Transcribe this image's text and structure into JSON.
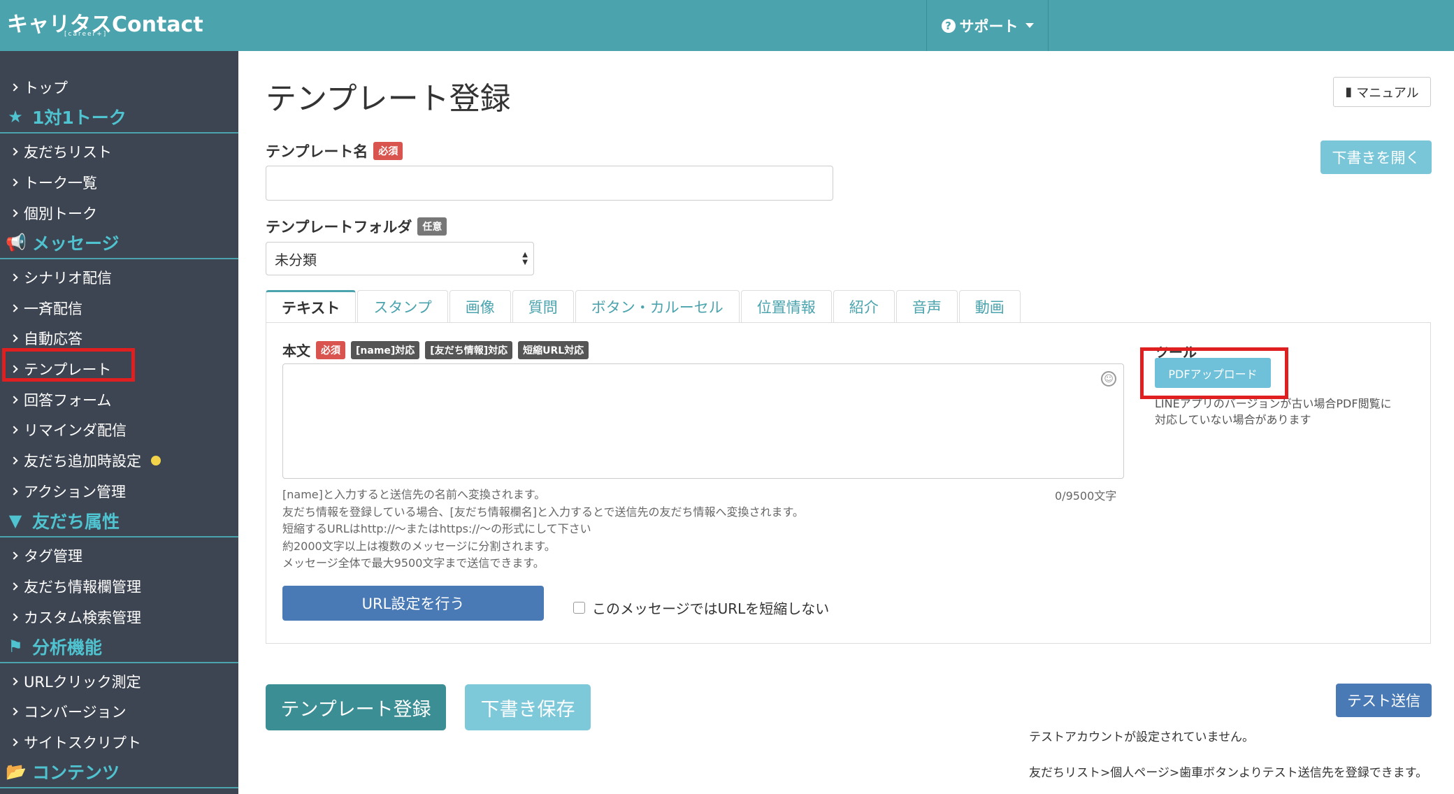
{
  "header": {
    "logo": "キャリタスContact",
    "logo_sub": "[career+]",
    "support_label": "サポート"
  },
  "sidebar": {
    "top": "トップ",
    "section_talk": "1対1トーク",
    "friend_list": "友だちリスト",
    "talk_list": "トーク一覧",
    "individual_talk": "個別トーク",
    "section_message": "メッセージ",
    "scenario": "シナリオ配信",
    "broadcast": "一斉配信",
    "auto_reply": "自動応答",
    "template": "テンプレート",
    "answer_form": "回答フォーム",
    "reminder": "リマインダ配信",
    "friend_add": "友だち追加時設定",
    "action": "アクション管理",
    "section_attr": "友だち属性",
    "tag": "タグ管理",
    "friend_info": "友だち情報欄管理",
    "custom_search": "カスタム検索管理",
    "section_analysis": "分析機能",
    "url_click": "URLクリック測定",
    "conversion": "コンバージョン",
    "site_script": "サイトスクリプト",
    "section_contents": "コンテンツ"
  },
  "main": {
    "title": "テンプレート登録",
    "manual": "マニュアル",
    "open_draft": "下書きを開く",
    "name_label": "テンプレート名",
    "required": "必須",
    "folder_label": "テンプレートフォルダ",
    "optional": "任意",
    "folder_value": "未分類",
    "tabs": [
      "テキスト",
      "スタンプ",
      "画像",
      "質問",
      "ボタン・カルーセル",
      "位置情報",
      "紹介",
      "音声",
      "動画"
    ],
    "body_label": "本文",
    "badge_name": "[name]対応",
    "badge_friend": "[友だち情報]対応",
    "badge_short": "短縮URL対応",
    "counter": "0/9500文字",
    "help": [
      "[name]と入力すると送信先の名前へ変換されます。",
      "友だち情報を登録している場合、[友だち情報欄名]と入力するとで送信先の友だち情報へ変換されます。",
      "短縮するURLはhttp://〜またはhttps://〜の形式にして下さい",
      "約2000文字以上は複数のメッセージに分割されます。",
      "メッセージ全体で最大9500文字まで送信できます。"
    ],
    "url_button": "URL設定を行う",
    "no_shorten": "このメッセージではURLを短縮しない",
    "tool_title": "ツール",
    "pdf_button": "PDFアップロード",
    "tool_note1": "LINEアプリのバージョンが古い場合PDF閲覧に",
    "tool_note2": "対応していない場合があります",
    "register": "テンプレート登録",
    "save_draft": "下書き保存",
    "test_send": "テスト送信",
    "test_note1": "テストアカウントが設定されていません。",
    "test_note2": "友だちリスト>個人ページ>歯車ボタンよりテスト送信先を登録できます。"
  },
  "colors": {
    "header": "#4aa3ad",
    "sidebar": "#3e4552",
    "accent": "#4fc3d0",
    "highlight": "#e02020"
  }
}
